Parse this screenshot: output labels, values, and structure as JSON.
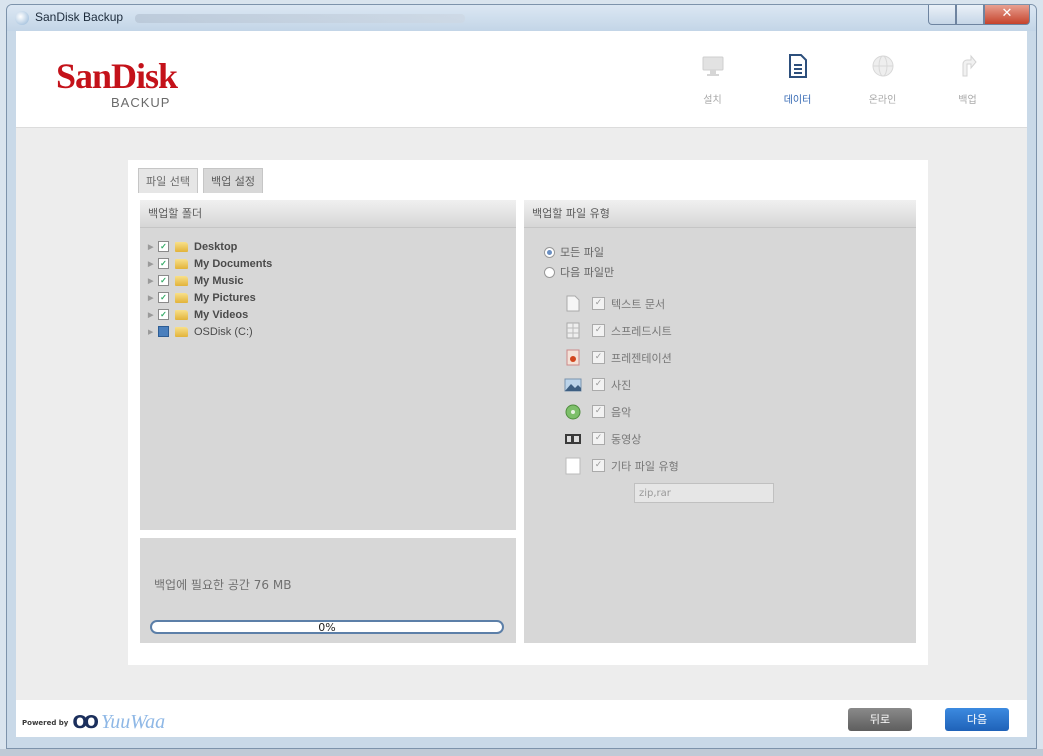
{
  "window": {
    "title": "SanDisk Backup"
  },
  "header": {
    "logo": "SanDisk",
    "logo_sub": "BACKUP",
    "steps": [
      {
        "label": "설치",
        "icon": "monitor-icon",
        "active": false
      },
      {
        "label": "데이터",
        "icon": "document-icon",
        "active": true
      },
      {
        "label": "온라인",
        "icon": "globe-icon",
        "active": false
      },
      {
        "label": "백업",
        "icon": "arrow-icon",
        "active": false
      }
    ]
  },
  "tabs": [
    "파일 선택",
    "백업 설정"
  ],
  "folders": {
    "heading": "백업할 폴더",
    "items": [
      {
        "label": "Desktop",
        "checked": true
      },
      {
        "label": "My Documents",
        "checked": true
      },
      {
        "label": "My Music",
        "checked": true
      },
      {
        "label": "My Pictures",
        "checked": true
      },
      {
        "label": "My Videos",
        "checked": true
      },
      {
        "label": "OSDisk (C:)",
        "checked": "partial"
      }
    ]
  },
  "space": {
    "text": "백업에 필요한 공간 76 MB",
    "progress_fraction": 0,
    "progress_label": "0%"
  },
  "file_types": {
    "heading": "백업할 파일 유형",
    "options": [
      {
        "label": "모든 파일",
        "selected": true
      },
      {
        "label": "다음 파일만",
        "selected": false
      }
    ],
    "types": [
      {
        "label": "텍스트 문서",
        "icon": "text-doc-icon"
      },
      {
        "label": "스프레드시트",
        "icon": "spreadsheet-icon"
      },
      {
        "label": "프레젠테이션",
        "icon": "presentation-icon"
      },
      {
        "label": "사진",
        "icon": "photo-icon"
      },
      {
        "label": "음악",
        "icon": "music-icon"
      },
      {
        "label": "동영상",
        "icon": "video-icon"
      },
      {
        "label": "기타 파일 유형",
        "icon": "other-file-icon"
      }
    ],
    "other_ext": "zip,rar"
  },
  "footer": {
    "powered_by": "Powered by",
    "brand": "YuuWaa",
    "back_label": "뒤로",
    "next_label": "다음"
  },
  "colors": {
    "brand_red": "#c4121a",
    "accent_blue": "#3569b4",
    "next_button": "#2a74cc"
  }
}
